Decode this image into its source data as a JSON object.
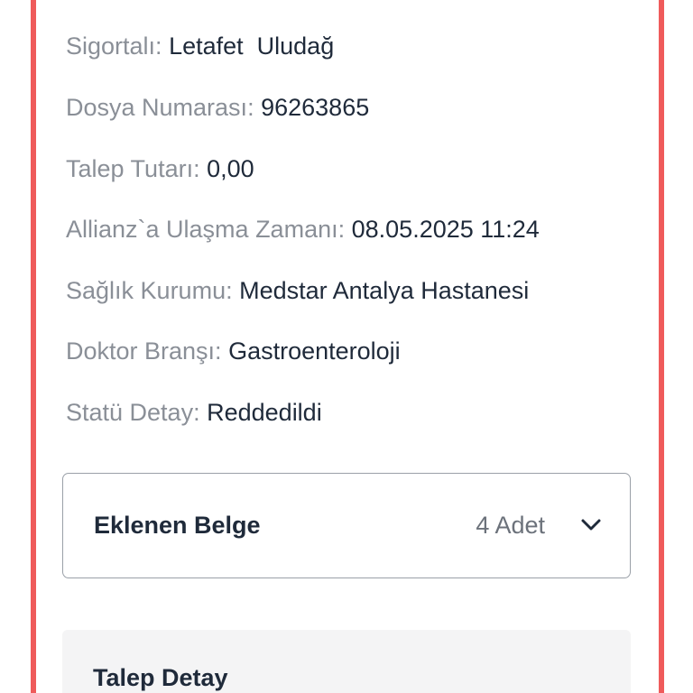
{
  "details": [
    {
      "label": "Sigortalı:",
      "value": "Letafet  Uludağ"
    },
    {
      "label": "Dosya Numarası:",
      "value": "96263865"
    },
    {
      "label": "Talep Tutarı:",
      "value": "0,00"
    },
    {
      "label": "Allianz`a Ulaşma Zamanı:",
      "value": "08.05.2025 11:24"
    },
    {
      "label": "Sağlık Kurumu:",
      "value": "Medstar Antalya Hastanesi"
    },
    {
      "label": "Doktor Branşı:",
      "value": "Gastroenteroloji"
    },
    {
      "label": "Statü Detay:",
      "value": "Reddedildi"
    }
  ],
  "documents": {
    "title": "Eklenen Belge",
    "count": "4 Adet",
    "expand_icon": "chevron-down-icon"
  },
  "request_detail": {
    "title": "Talep Detay"
  },
  "colors": {
    "card_border": "#ef5b5b",
    "label": "#8a8f97",
    "value": "#1f2a3a",
    "section_bg": "#f4f4f5"
  }
}
